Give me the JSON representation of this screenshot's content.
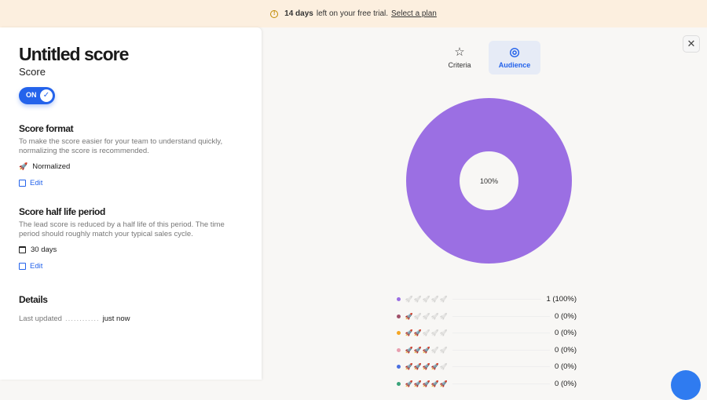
{
  "banner": {
    "days": "14 days",
    "text": "left on your free trial.",
    "link": "Select a plan"
  },
  "title": "Untitled score",
  "subtitle": "Score",
  "toggle": {
    "label": "ON",
    "state": true
  },
  "score_format": {
    "heading": "Score format",
    "description": "To make the score easier for your team to understand quickly, normalizing the score is recommended.",
    "value": "Normalized",
    "edit": "Edit"
  },
  "half_life": {
    "heading": "Score half life period",
    "description": "The lead score is reduced by a half life of this period. The time period should roughly match your typical sales cycle.",
    "value": "30 days",
    "edit": "Edit"
  },
  "details": {
    "heading": "Details",
    "last_updated_label": "Last updated",
    "dots": "............",
    "last_updated_value": "just now"
  },
  "tabs": [
    {
      "label": "Criteria",
      "icon": "star-icon"
    },
    {
      "label": "Audience",
      "icon": "target-icon",
      "active": true
    }
  ],
  "chart_data": {
    "type": "pie",
    "center_label": "100%",
    "slices": [
      {
        "rank": 0,
        "count": 1,
        "percent": 100
      }
    ],
    "legend": [
      {
        "rank": 0,
        "color": "#9b6fe3",
        "label": "1 (100%)"
      },
      {
        "rank": 1,
        "color": "#a0506a",
        "label": "0 (0%)"
      },
      {
        "rank": 2,
        "color": "#f5a623",
        "label": "0 (0%)"
      },
      {
        "rank": 3,
        "color": "#e8a0b0",
        "label": "0 (0%)"
      },
      {
        "rank": 4,
        "color": "#4a6fe0",
        "label": "0 (0%)"
      },
      {
        "rank": 5,
        "color": "#3aa37a",
        "label": "0 (0%)"
      }
    ]
  }
}
